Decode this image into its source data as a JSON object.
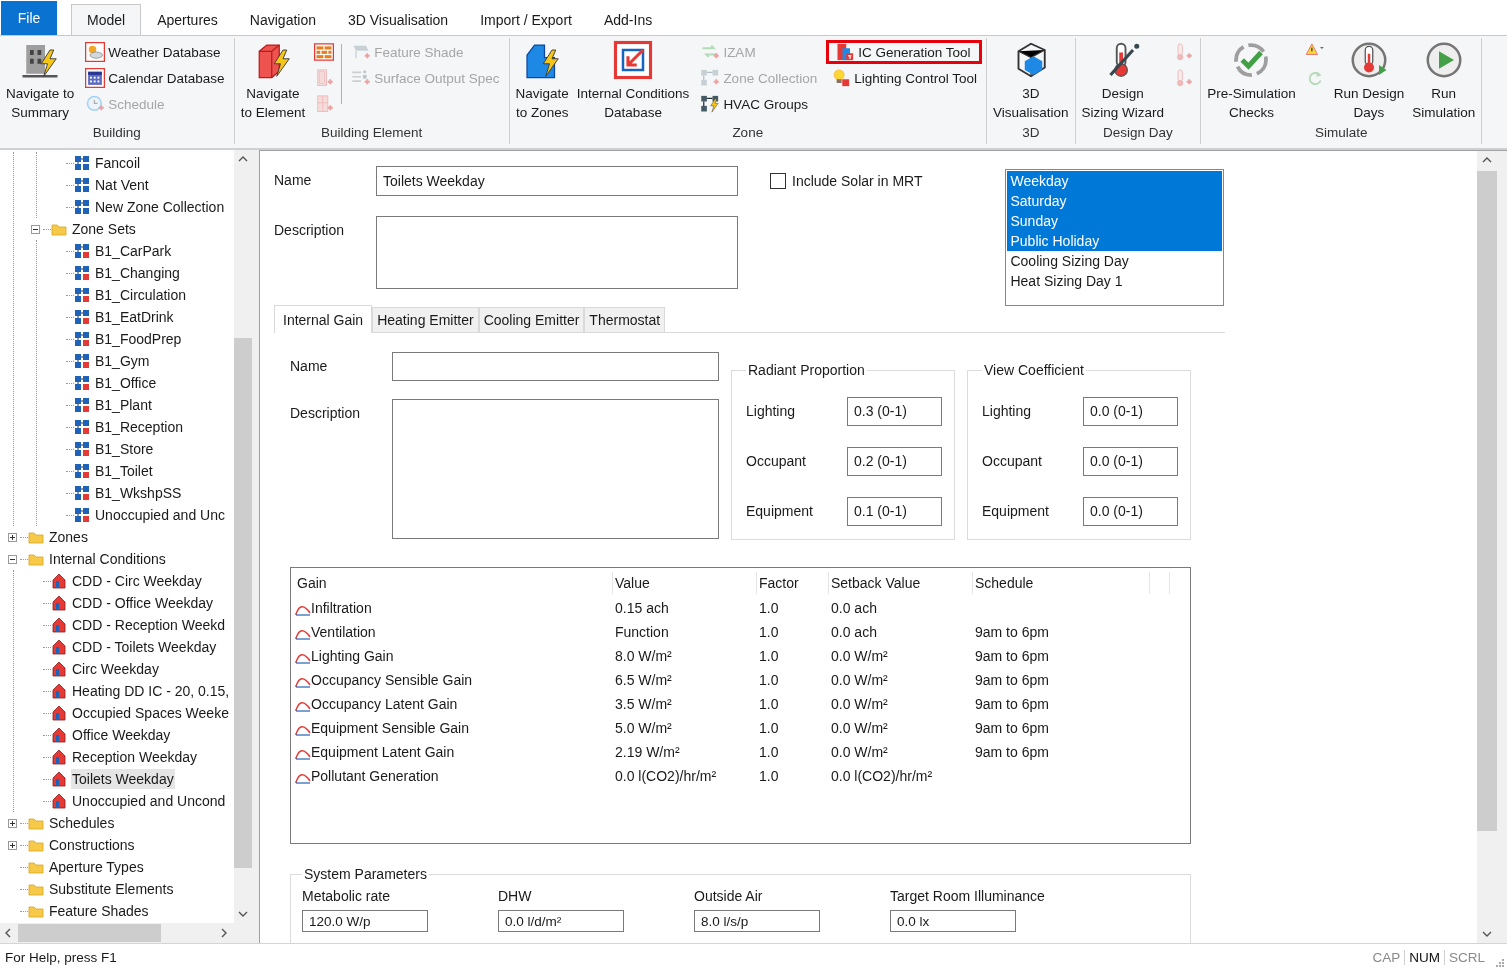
{
  "ribbon_tabs": [
    {
      "label": "File",
      "kind": "file",
      "selected": false
    },
    {
      "label": "Model",
      "kind": "tab",
      "selected": true
    },
    {
      "label": "Apertures",
      "kind": "tab",
      "selected": false
    },
    {
      "label": "Navigation",
      "kind": "tab",
      "selected": false
    },
    {
      "label": "3D Visualisation",
      "kind": "tab",
      "selected": false
    },
    {
      "label": "Import / Export",
      "kind": "tab",
      "selected": false
    },
    {
      "label": "Add-Ins",
      "kind": "tab",
      "selected": false
    }
  ],
  "ribbon_groups": [
    {
      "label": "Building",
      "items": [
        {
          "kind": "large",
          "label": "Navigate to\nSummary",
          "disabled": false
        },
        {
          "kind": "stack",
          "items": [
            {
              "label": "Weather Database",
              "disabled": false,
              "highlighted": false
            },
            {
              "label": "Calendar Database",
              "disabled": false,
              "highlighted": false
            },
            {
              "label": "Schedule",
              "disabled": true,
              "highlighted": false
            }
          ]
        }
      ]
    },
    {
      "label": "Building Element",
      "items": [
        {
          "kind": "large",
          "label": "Navigate\nto Element",
          "disabled": false
        },
        {
          "kind": "stack",
          "items": [
            {
              "disabled": false,
              "highlighted": false
            },
            {
              "disabled": true,
              "highlighted": false
            },
            {
              "disabled": true,
              "highlighted": false
            }
          ]
        },
        {
          "kind": "separator"
        },
        {
          "kind": "stack",
          "items": [
            {
              "label": "Feature Shade",
              "disabled": true,
              "highlighted": false
            },
            {
              "label": "Surface Output Spec",
              "disabled": true,
              "highlighted": false
            }
          ]
        }
      ]
    },
    {
      "label": "Zone",
      "items": [
        {
          "kind": "large",
          "label": "Navigate\nto Zones",
          "disabled": false
        },
        {
          "kind": "large",
          "label": "Internal Conditions\nDatabase",
          "disabled": false
        },
        {
          "kind": "stack",
          "items": [
            {
              "label": "IZAM",
              "disabled": true,
              "highlighted": false
            },
            {
              "label": "Zone Collection",
              "disabled": true,
              "highlighted": false
            },
            {
              "label": "HVAC Groups",
              "disabled": false,
              "highlighted": false
            }
          ]
        },
        {
          "kind": "stack",
          "items": [
            {
              "label": "IC Generation Tool",
              "disabled": false,
              "highlighted": true
            },
            {
              "label": "Lighting Control Tool",
              "disabled": false,
              "highlighted": false
            }
          ]
        }
      ]
    },
    {
      "label": "3D",
      "items": [
        {
          "kind": "large",
          "label": "3D\nVisualisation",
          "disabled": false
        }
      ]
    },
    {
      "label": "Design Day",
      "items": [
        {
          "kind": "large",
          "label": "Design\nSizing Wizard",
          "disabled": false
        },
        {
          "kind": "stack",
          "items": [
            {
              "disabled": true,
              "highlighted": false
            },
            {
              "disabled": true,
              "highlighted": false
            }
          ]
        }
      ]
    },
    {
      "label": "Simulate",
      "items": [
        {
          "kind": "large",
          "label": "Pre-Simulation\nChecks",
          "disabled": false
        },
        {
          "kind": "stack",
          "items": [
            {
              "disabled": false,
              "highlighted": false
            },
            {
              "disabled": true,
              "highlighted": false
            }
          ]
        },
        {
          "kind": "large",
          "label": "Run Design\nDays",
          "disabled": false
        },
        {
          "kind": "large",
          "label": "Run\nSimulation",
          "disabled": false
        }
      ]
    }
  ],
  "tree": [
    {
      "children": [
        {
          "children": [
            {
              "label": "Fancoil",
              "kind": "collection",
              "selected": false
            },
            {
              "label": "Nat Vent",
              "kind": "collection",
              "selected": false
            },
            {
              "label": "New Zone Collection",
              "kind": "collection",
              "selected": false
            }
          ]
        },
        {
          "label": "Zone Sets",
          "kind": "folder",
          "selected": false,
          "expanded": true,
          "children": [
            {
              "label": "B1_CarPark",
              "kind": "zone-set",
              "selected": false
            },
            {
              "label": "B1_Changing",
              "kind": "zone-set",
              "selected": false
            },
            {
              "label": "B1_Circulation",
              "kind": "zone-set",
              "selected": false
            },
            {
              "label": "B1_EatDrink",
              "kind": "zone-set",
              "selected": false
            },
            {
              "label": "B1_FoodPrep",
              "kind": "zone-set",
              "selected": false
            },
            {
              "label": "B1_Gym",
              "kind": "zone-set",
              "selected": false
            },
            {
              "label": "B1_Office",
              "kind": "zone-set",
              "selected": false
            },
            {
              "label": "B1_Plant",
              "kind": "zone-set",
              "selected": false
            },
            {
              "label": "B1_Reception",
              "kind": "zone-set",
              "selected": false
            },
            {
              "label": "B1_Store",
              "kind": "zone-set",
              "selected": false
            },
            {
              "label": "B1_Toilet",
              "kind": "zone-set",
              "selected": false
            },
            {
              "label": "B1_WkshpSS",
              "kind": "zone-set",
              "selected": false
            },
            {
              "label": "Unoccupied and Unc",
              "kind": "zone-set",
              "selected": false
            }
          ]
        }
      ]
    },
    {
      "label": "Zones",
      "kind": "folder",
      "selected": false,
      "expanded": false
    },
    {
      "label": "Internal Conditions",
      "kind": "folder",
      "selected": false,
      "expanded": true,
      "children": [
        {
          "label": "CDD - Circ Weekday",
          "kind": "condition",
          "selected": false
        },
        {
          "label": "CDD - Office Weekday",
          "kind": "condition",
          "selected": false
        },
        {
          "label": "CDD - Reception Weekd",
          "kind": "condition",
          "selected": false
        },
        {
          "label": "CDD - Toilets Weekday",
          "kind": "condition",
          "selected": false
        },
        {
          "label": "Circ Weekday",
          "kind": "condition",
          "selected": false
        },
        {
          "label": "Heating DD IC - 20, 0.15,",
          "kind": "condition",
          "selected": false
        },
        {
          "label": "Occupied Spaces Weeke",
          "kind": "condition",
          "selected": false
        },
        {
          "label": "Office Weekday",
          "kind": "condition",
          "selected": false
        },
        {
          "label": "Reception Weekday",
          "kind": "condition",
          "selected": false
        },
        {
          "label": "Toilets Weekday",
          "kind": "condition",
          "selected": true
        },
        {
          "label": "Unoccupied and Uncond",
          "kind": "condition",
          "selected": false
        }
      ]
    },
    {
      "label": "Schedules",
      "kind": "folder",
      "selected": false,
      "expanded": false
    },
    {
      "label": "Constructions",
      "kind": "folder",
      "selected": false,
      "expanded": false
    },
    {
      "label": "Aperture Types",
      "kind": "folder",
      "selected": false
    },
    {
      "label": "Substitute Elements",
      "kind": "folder",
      "selected": false
    },
    {
      "label": "Feature Shades",
      "kind": "folder",
      "selected": false
    }
  ],
  "form": {
    "name_label": "Name",
    "name_value": "Toilets Weekday",
    "description_label": "Description",
    "solar_checkbox": {
      "label": "Include Solar in MRT",
      "checked": false
    },
    "day_types": [
      {
        "label": "Weekday",
        "selected": true
      },
      {
        "label": "Saturday",
        "selected": true
      },
      {
        "label": "Sunday",
        "selected": true
      },
      {
        "label": "Public Holiday",
        "selected": true
      },
      {
        "label": "Cooling Sizing Day",
        "selected": false
      },
      {
        "label": "Heat Sizing Day 1",
        "selected": false
      }
    ]
  },
  "detail_tabs": [
    {
      "label": "Internal Gain",
      "selected": true
    },
    {
      "label": "Heating Emitter",
      "selected": false
    },
    {
      "label": "Cooling Emitter",
      "selected": false
    },
    {
      "label": "Thermostat",
      "selected": false
    }
  ],
  "internal_gain": {
    "name_label": "Name",
    "description_label": "Description",
    "group_boxes": [
      {
        "title": "Radiant Proportion",
        "rows": [
          {
            "label": "Lighting",
            "value": "0.3 (0-1)"
          },
          {
            "label": "Occupant",
            "value": "0.2 (0-1)"
          },
          {
            "label": "Equipment",
            "value": "0.1 (0-1)"
          }
        ]
      },
      {
        "title": "View Coefficient",
        "rows": [
          {
            "label": "Lighting",
            "value": "0.0 (0-1)"
          },
          {
            "label": "Occupant",
            "value": "0.0 (0-1)"
          },
          {
            "label": "Equipment",
            "value": "0.0 (0-1)"
          }
        ]
      }
    ],
    "table": {
      "columns": [
        "Gain",
        "Value",
        "Factor",
        "Setback Value",
        "Schedule"
      ],
      "rows": [
        {
          "cells": [
            "Infiltration",
            "0.15 ach",
            "1.0",
            "0.0 ach"
          ]
        },
        {
          "cells": [
            "Ventilation",
            "Function",
            "1.0",
            "0.0 ach",
            "9am to 6pm"
          ]
        },
        {
          "cells": [
            "Lighting Gain",
            "8.0 W/m²",
            "1.0",
            "0.0 W/m²",
            "9am to 6pm"
          ]
        },
        {
          "cells": [
            "Occupancy Sensible Gain",
            "6.5 W/m²",
            "1.0",
            "0.0 W/m²",
            "9am to 6pm"
          ]
        },
        {
          "cells": [
            "Occupancy Latent Gain",
            "3.5 W/m²",
            "1.0",
            "0.0 W/m²",
            "9am to 6pm"
          ]
        },
        {
          "cells": [
            "Equipment Sensible Gain",
            "5.0 W/m²",
            "1.0",
            "0.0 W/m²",
            "9am to 6pm"
          ]
        },
        {
          "cells": [
            "Equipment Latent Gain",
            "2.19 W/m²",
            "1.0",
            "0.0 W/m²",
            "9am to 6pm"
          ]
        },
        {
          "cells": [
            "Pollutant Generation",
            "0.0 l(CO2)/hr/m²",
            "1.0",
            "0.0 l(CO2)/hr/m²"
          ]
        }
      ]
    }
  },
  "system_parameters": {
    "title": "System Parameters",
    "fields": [
      {
        "label": "Metabolic rate",
        "value": "120.0 W/p"
      },
      {
        "label": "DHW",
        "value": "0.0 l/d/m²"
      },
      {
        "label": "Outside Air",
        "value": "8.0 l/s/p"
      },
      {
        "label": "Target Room Illuminance",
        "value": "0.0 lx"
      }
    ]
  },
  "status_bar": {
    "text": "For Help, press F1",
    "indicators": [
      {
        "label": "CAP",
        "on": false
      },
      {
        "label": "NUM",
        "on": true
      },
      {
        "label": "SCRL",
        "on": false
      }
    ]
  }
}
